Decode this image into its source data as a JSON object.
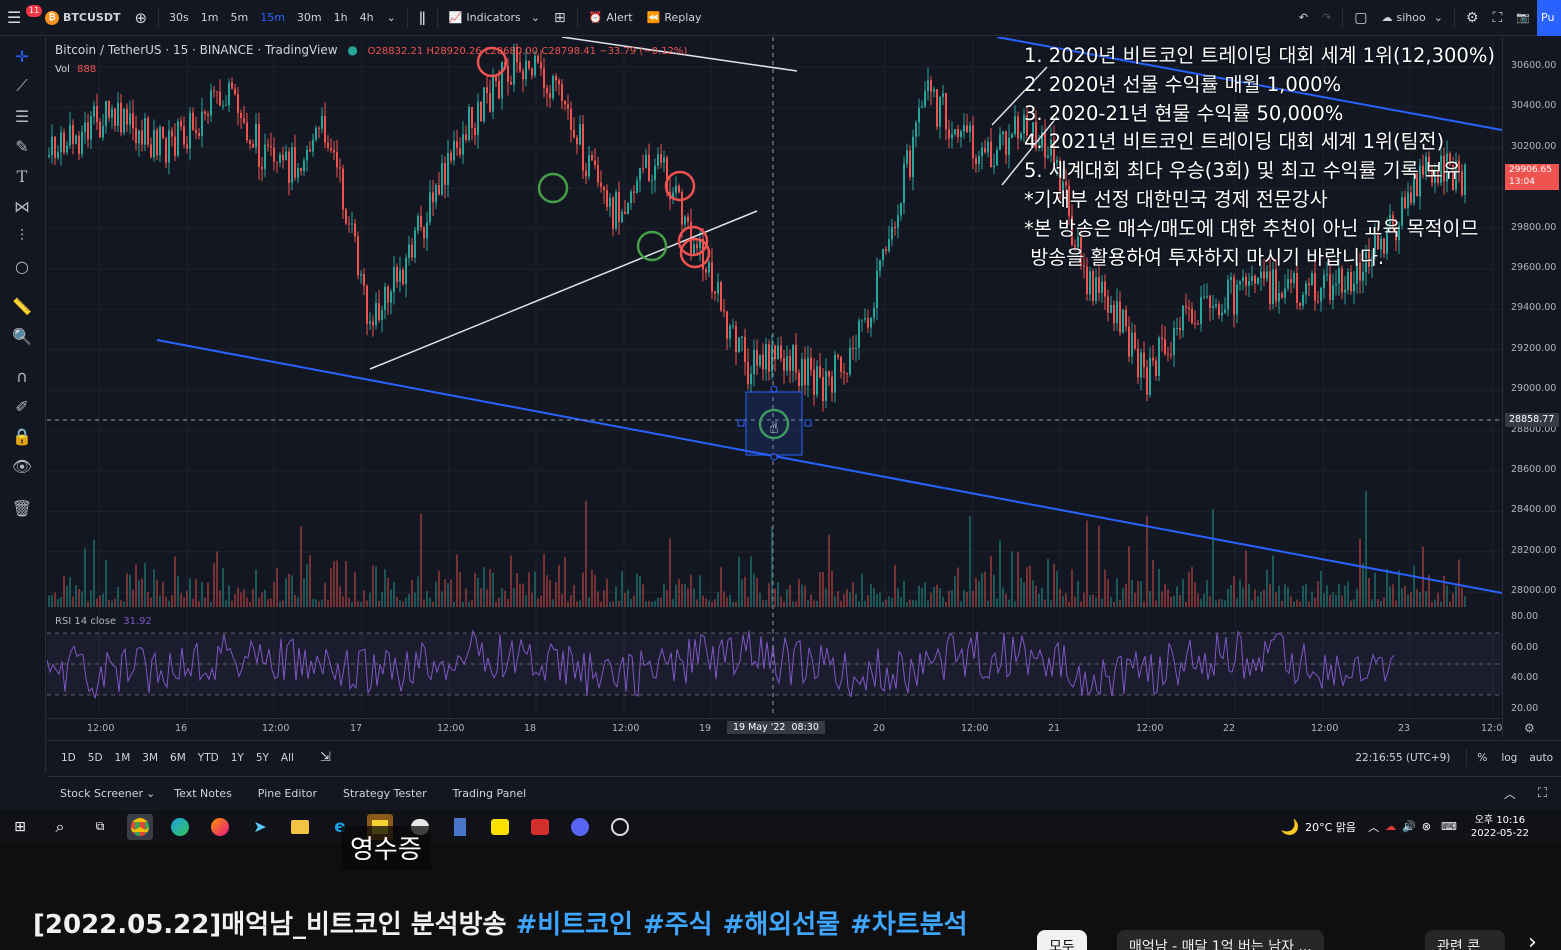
{
  "topbar": {
    "notif_count": "11",
    "symbol": "BTCUSDT",
    "intervals": [
      "30s",
      "1m",
      "5m",
      "15m",
      "30m",
      "1h",
      "4h"
    ],
    "active_interval": "15m",
    "indicators_label": "Indicators",
    "alert_label": "Alert",
    "replay_label": "Replay",
    "user": "sihoo",
    "publish": "Pu"
  },
  "legend": {
    "title": "Bitcoin / TetherUS · 15 · BINANCE · TradingView",
    "ohlc": "O28832.21 H28920.26 L28680.00 C28798.41 −33.79 (−0.12%)",
    "vol_label": "Vol",
    "vol_value": "888",
    "rsi_label": "RSI 14 close",
    "rsi_value": "31.92"
  },
  "overlay_lines": [
    "1. 2020년 비트코인 트레이딩 대회 세계 1위(12,300%)",
    "2. 2020년 선물 수익률 매월 1,000%",
    "3. 2020-21년 현물 수익률 50,000%",
    "4. 2021년 비트코인 트레이딩 대회 세계 1위(팀전)",
    "5. 세계대회 최다 우승(3회) 및 최고 수익률 기록 보유",
    "*기재부 선정 대한민국 경제 전문강사",
    "*본 방송은 매수/매도에 대한 추천이 아닌 교육 목적이므",
    " 방송을 활용하여 투자하지 마시기 바랍니다."
  ],
  "price_axis": {
    "ticks": [
      "30600.00",
      "30400.00",
      "30200.00",
      "30000.00",
      "29800.00",
      "29600.00",
      "29400.00",
      "29200.00",
      "29000.00",
      "28800.00",
      "28600.00",
      "28400.00",
      "28200.00",
      "28000.00"
    ],
    "current_price": "28858.77",
    "red_price": "29906.65",
    "red_time": "13:04",
    "rsi_ticks": [
      "80.00",
      "60.00",
      "40.00",
      "20.00"
    ]
  },
  "time_axis": {
    "labels": [
      "12:00",
      "16",
      "12:00",
      "17",
      "12:00",
      "18",
      "12:00",
      "19",
      "20",
      "12:00",
      "21",
      "12:00",
      "22",
      "12:00",
      "23",
      "12:0"
    ],
    "crosshair_label": "19 May '22  08:30"
  },
  "range_bar": {
    "ranges": [
      "1D",
      "5D",
      "1M",
      "3M",
      "6M",
      "YTD",
      "1Y",
      "5Y",
      "All"
    ],
    "clock": "22:16:55 (UTC+9)",
    "percent": "%",
    "log": "log",
    "auto": "auto"
  },
  "bottom_tabs": [
    "Stock Screener",
    "Text Notes",
    "Pine Editor",
    "Strategy Tester",
    "Trading Panel"
  ],
  "taskbar": {
    "weather": "20°C 맑음",
    "ampm_time": "오후 10:16",
    "date": "2022-05-22"
  },
  "caption": "영수증",
  "video": {
    "title_main": "[2022.05.22]매억남_비트코인 분석방송 ",
    "hashtags": [
      "#비트코인",
      "#주식",
      "#해외선물",
      "#차트분석"
    ],
    "chips": [
      "모두",
      "매억남 - 매달 1억 버는 남자 ...",
      "관련 콘"
    ]
  },
  "colors": {
    "bg": "#131722",
    "up": "#26a69a",
    "down": "#ef5350",
    "trend": "#2962ff",
    "rsi": "#7e57c2",
    "hashtag": "#3ea6ff"
  }
}
